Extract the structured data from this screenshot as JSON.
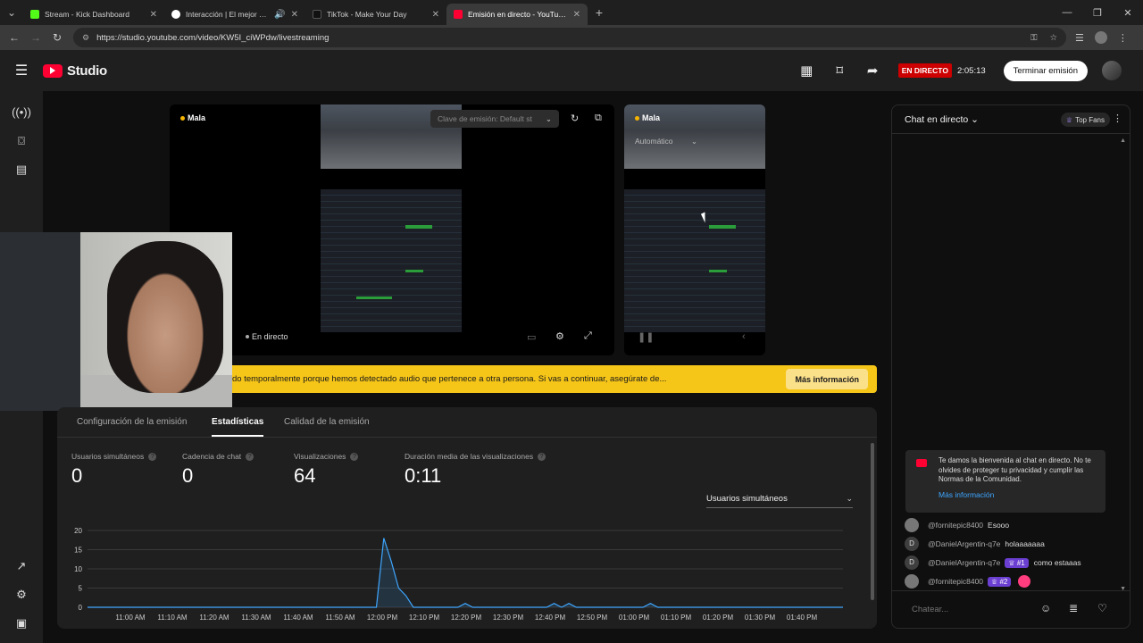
{
  "browser": {
    "tabs": [
      {
        "title": "Stream - Kick Dashboard",
        "favicon_color": "#53fc18",
        "active": false
      },
      {
        "title": "Interacción | El mejor software",
        "favicon_color": "#ffffff",
        "active": false
      },
      {
        "title": "TikTok - Make Your Day",
        "favicon_color": "#111111",
        "active": false
      },
      {
        "title": "Emisión en directo - YouTube Studio",
        "favicon_color": "#ff0033",
        "active": true
      }
    ],
    "url": "https://studio.youtube.com/video/KW5I_ciWPdw/livestreaming"
  },
  "header": {
    "logo_text": "Studio",
    "live_badge": "EN DIRECTO",
    "live_time": "2:05:13",
    "end_button": "Terminar emisión"
  },
  "preview": {
    "tag_main": "Mala",
    "tag_secondary": "Mala",
    "stream_key": "Clave de emisión: Default st",
    "quality": "Automático",
    "live_label": "En directo"
  },
  "banner": {
    "text": "do temporalmente porque hemos detectado audio que pertenece a otra persona. Si vas a continuar, asegúrate de...",
    "button": "Más información",
    "color": "#f5c518"
  },
  "panel": {
    "tabs": [
      "Configuración de la emisión",
      "Estadísticas",
      "Calidad de la emisión"
    ],
    "active_tab": 1,
    "metrics": [
      {
        "label": "Usuarios simultáneos",
        "value": "0"
      },
      {
        "label": "Cadencia de chat",
        "value": "0"
      },
      {
        "label": "Visualizaciones",
        "value": "64"
      },
      {
        "label": "Duración media de las visualizaciones",
        "value": "0:11"
      }
    ],
    "selector": "Usuarios simultáneos"
  },
  "chart_data": {
    "type": "line",
    "x": [
      "11:00 AM",
      "11:10 AM",
      "11:20 AM",
      "11:30 AM",
      "11:40 AM",
      "11:50 AM",
      "12:00 PM",
      "12:10 PM",
      "12:20 PM",
      "12:30 PM",
      "12:40 PM",
      "12:50 PM",
      "01:00 PM",
      "01:10 PM",
      "01:20 PM",
      "01:30 PM",
      "01:40 PM"
    ],
    "series": [
      {
        "values": [
          0,
          0,
          0,
          0,
          0,
          0,
          0,
          0,
          0,
          0,
          0,
          0,
          0,
          0,
          0,
          0,
          0
        ],
        "points": [
          [
            0,
            0
          ],
          [
            39,
            0
          ],
          [
            40,
            18
          ],
          [
            41,
            12
          ],
          [
            42,
            5
          ],
          [
            43,
            3
          ],
          [
            44,
            0
          ],
          [
            50,
            0
          ],
          [
            51,
            1
          ],
          [
            52,
            0
          ],
          [
            62,
            0
          ],
          [
            63,
            1
          ],
          [
            64,
            0
          ],
          [
            65,
            1
          ],
          [
            66,
            0
          ],
          [
            75,
            0
          ],
          [
            76,
            1
          ],
          [
            77,
            0
          ],
          [
            102,
            0
          ]
        ]
      }
    ],
    "yticks": [
      0,
      5,
      10,
      15,
      20
    ],
    "ylim": [
      0,
      20
    ],
    "color": "#3ea6ff"
  },
  "chat": {
    "title": "Chat en directo",
    "top_fans": "Top Fans",
    "welcome_text": "Te damos la bienvenida al chat en directo. No te olvides de proteger tu privacidad y cumplir las Normas de la Comunidad.",
    "welcome_link": "Más información",
    "messages": [
      {
        "user": "@fornitepic8400",
        "text": "Esooo",
        "badge": "",
        "avatar": ""
      },
      {
        "user": "@DanielArgentin-q7e",
        "text": "holaaaaaaa",
        "badge": "",
        "avatar": "D"
      },
      {
        "user": "@DanielArgentin-q7e",
        "text": "como estaaas",
        "badge": "#1",
        "avatar": "D"
      },
      {
        "user": "@fornitepic8400",
        "text": "",
        "badge": "#2",
        "avatar": ""
      }
    ],
    "input_placeholder": "Chatear..."
  }
}
